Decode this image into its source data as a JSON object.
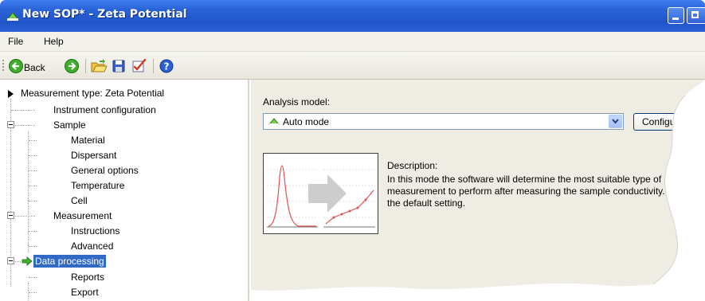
{
  "window": {
    "title": "New SOP* - Zeta Potential",
    "accent": "#2a63d8"
  },
  "menu": {
    "items": [
      "File",
      "Help"
    ]
  },
  "toolbar": {
    "back_label": "Back",
    "icons": [
      "back-arrow-icon",
      "forward-arrow-icon",
      "open-folder-icon",
      "save-disk-icon",
      "edit-check-icon",
      "help-icon"
    ]
  },
  "tree": {
    "root": "Measurement type: Zeta Potential",
    "items": [
      {
        "label": "Instrument configuration"
      },
      {
        "label": "Sample"
      },
      {
        "label": "Material"
      },
      {
        "label": "Dispersant"
      },
      {
        "label": "General options"
      },
      {
        "label": "Temperature"
      },
      {
        "label": "Cell"
      },
      {
        "label": "Measurement"
      },
      {
        "label": "Instructions"
      },
      {
        "label": "Advanced"
      },
      {
        "label": "Data processing"
      },
      {
        "label": "Reports"
      },
      {
        "label": "Export"
      }
    ],
    "selected": "Data processing",
    "selection_color": "#316ac5"
  },
  "content": {
    "analysis_label": "Analysis model:",
    "analysis_value": "Auto mode",
    "configure_label": "Configure",
    "description_heading": "Description:",
    "description_lines": [
      "In this mode the software will determine the most suitable type of",
      "measurement to perform after measuring the sample conductivity. T",
      "the default setting."
    ]
  }
}
